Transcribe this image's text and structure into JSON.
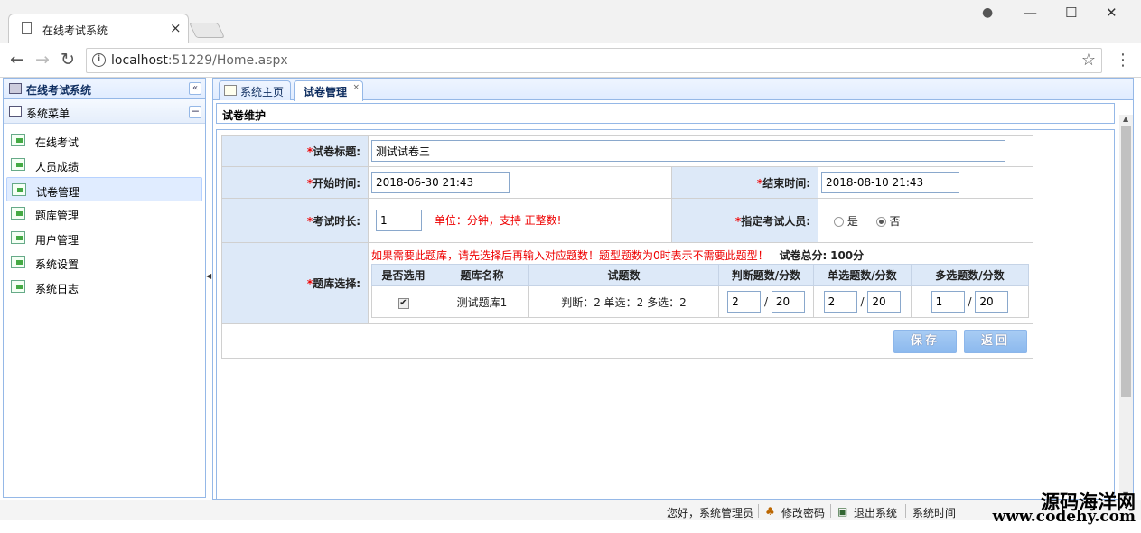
{
  "browser": {
    "tab_title": "在线考试系统",
    "tab_close": "×",
    "url_host": "localhost",
    "url_rest": ":51229/Home.aspx",
    "back": "←",
    "forward": "→",
    "reload": "↻",
    "star": "☆",
    "menu": "⋮",
    "win_min": "—",
    "win_max": "☐",
    "win_close": "✕"
  },
  "west": {
    "title": "在线考试系统",
    "collapse": "«",
    "accordion_title": "系统菜单",
    "accordion_toggle": "−",
    "items": [
      {
        "label": "在线考试"
      },
      {
        "label": "人员成绩"
      },
      {
        "label": "试卷管理"
      },
      {
        "label": "题库管理"
      },
      {
        "label": "用户管理"
      },
      {
        "label": "系统设置"
      },
      {
        "label": "系统日志"
      }
    ]
  },
  "center": {
    "tabs": [
      {
        "label": "系统主页"
      },
      {
        "label": "试卷管理",
        "close": "×"
      }
    ],
    "panel_title": "试卷维护"
  },
  "form": {
    "title_label": "试卷标题:",
    "title_value": "测试试卷三",
    "start_label": "开始时间:",
    "start_value": "2018-06-30 21:43",
    "end_label": "结束时间:",
    "end_value": "2018-08-10 21:43",
    "duration_label": "考试时长:",
    "duration_value": "1",
    "duration_hint": "单位：分钟，支持 正整数!",
    "assign_label": "指定考试人员:",
    "assign_yes": "是",
    "assign_no": "否",
    "assign_selected": "否",
    "bank_label": "题库选择:",
    "bank_hint": "如果需要此题库，请先选择后再输入对应题数！题型题数为0时表示不需要此题型！",
    "total_label": "试卷总分:",
    "total_value": "100分",
    "required_mark": "*"
  },
  "bank_table": {
    "headers": [
      "是否选用",
      "题库名称",
      "试题数",
      "判断题数/分数",
      "单选题数/分数",
      "多选题数/分数"
    ],
    "rows": [
      {
        "selected": "✔",
        "name": "测试题库1",
        "counts": "判断：2 单选：2 多选：2",
        "judge_count": "2",
        "judge_score": "20",
        "single_count": "2",
        "single_score": "20",
        "multi_count": "1",
        "multi_score": "20",
        "slash": "/"
      }
    ]
  },
  "buttons": {
    "save": "保存",
    "back": "返回"
  },
  "status": {
    "greeting": "您好，系统管理员",
    "change_pwd": "修改密码",
    "logout": "退出系统",
    "time_label": "系统时间",
    "watermark_cn": "源码海洋网",
    "watermark_url": "www.codehy.com"
  }
}
